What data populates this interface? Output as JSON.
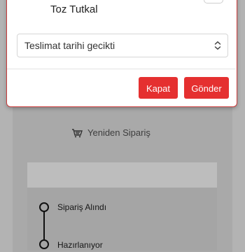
{
  "modal": {
    "product_name": "Toz Tutkal",
    "reason_select": {
      "value": "Teslimat tarihi gecikti"
    },
    "close_label": "Kapat",
    "send_label": "Gönder"
  },
  "page": {
    "reorder_label": "Yeniden Sipariş",
    "timeline": [
      {
        "label": "Sipariş Alındı"
      },
      {
        "label": "Hazırlanıyor"
      }
    ]
  },
  "colors": {
    "accent": "#e53030",
    "overlay": "#b3b3b3",
    "checkbox_checked": "#2f6fdb"
  }
}
